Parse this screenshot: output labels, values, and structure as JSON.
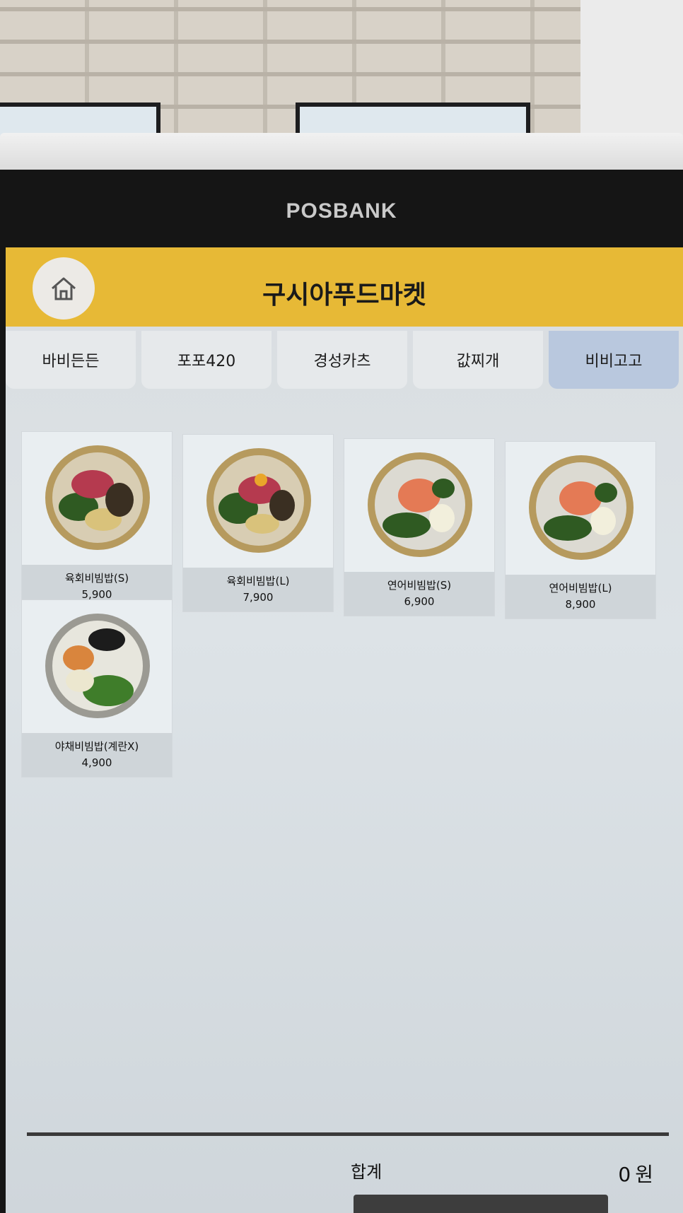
{
  "device": {
    "brand": "POSBANK"
  },
  "header": {
    "title": "구시아푸드마켓",
    "home_icon": "home-icon"
  },
  "tabs": [
    {
      "label": "바비든든",
      "active": false
    },
    {
      "label": "포포420",
      "active": false
    },
    {
      "label": "경성카츠",
      "active": false
    },
    {
      "label": "값찌개",
      "active": false
    },
    {
      "label": "비비고고",
      "active": true
    }
  ],
  "menu": [
    {
      "name": "육회비빔밥(S)",
      "price": "5,900"
    },
    {
      "name": "육회비빔밥(L)",
      "price": "7,900"
    },
    {
      "name": "연어비빔밥(S)",
      "price": "6,900"
    },
    {
      "name": "연어비빔밥(L)",
      "price": "8,900"
    },
    {
      "name": "야채비빔밥(계란X)",
      "price": "4,900"
    }
  ],
  "summary": {
    "total_label": "합계",
    "total_value": "0",
    "currency": "원"
  },
  "colors": {
    "header": "#e7b936",
    "active_tab": "#b9c8de"
  }
}
